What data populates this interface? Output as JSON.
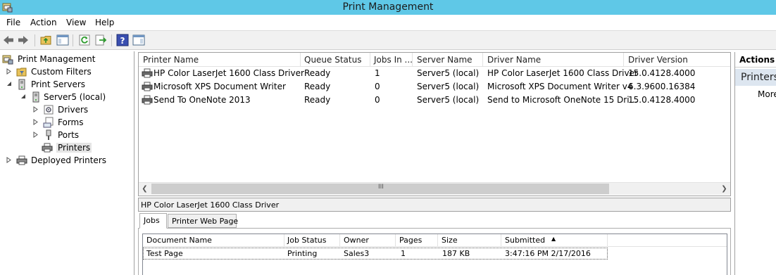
{
  "window": {
    "title": "Print Management"
  },
  "menu": [
    "File",
    "Action",
    "View",
    "Help"
  ],
  "toolbar": {
    "icons": [
      "back-arrow-icon",
      "forward-arrow-icon",
      "up-folder-icon",
      "show-hide-tree-icon",
      "refresh-icon",
      "export-list-icon",
      "help-icon",
      "show-hide-action-pane-icon"
    ]
  },
  "tree": {
    "root": "Print Management",
    "custom_filters": "Custom Filters",
    "print_servers": "Print Servers",
    "server": "Server5 (local)",
    "drivers": "Drivers",
    "forms": "Forms",
    "ports": "Ports",
    "printers": "Printers",
    "deployed_printers": "Deployed Printers"
  },
  "printer_list": {
    "columns": [
      "Printer Name",
      "Queue Status",
      "Jobs In ...",
      "Server Name",
      "Driver Name",
      "Driver Version"
    ],
    "rows": [
      [
        "HP Color LaserJet 1600 Class Driver",
        "Ready",
        "1",
        "Server5 (local)",
        "HP Color LaserJet 1600 Class Driver",
        "15.0.4128.4000"
      ],
      [
        "Microsoft XPS Document Writer",
        "Ready",
        "0",
        "Server5 (local)",
        "Microsoft XPS Document Writer v4",
        "6.3.9600.16384"
      ],
      [
        "Send To OneNote 2013",
        "Ready",
        "0",
        "Server5 (local)",
        "Send to Microsoft OneNote 15 Dri...",
        "15.0.4128.4000"
      ]
    ],
    "scroll_grip": "III"
  },
  "detail": {
    "title": "HP Color LaserJet 1600 Class Driver",
    "tabs": [
      "Jobs",
      "Printer Web Page"
    ],
    "job_columns": [
      "Document Name",
      "Job Status",
      "Owner",
      "Pages",
      "Size",
      "Submitted"
    ],
    "jobs": [
      [
        "Test Page",
        "Printing",
        "Sales3",
        "1",
        "187 KB",
        "3:47:16 PM  2/17/2016"
      ]
    ]
  },
  "actions": {
    "header": "Actions",
    "section": "Printers",
    "more": "More"
  }
}
